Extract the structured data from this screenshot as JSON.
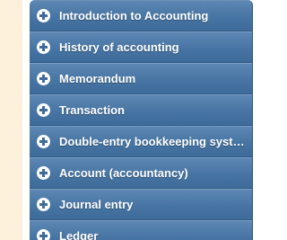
{
  "accordion": {
    "items": [
      {
        "label": "Introduction to Accounting",
        "icon": "plus-icon"
      },
      {
        "label": "History of accounting",
        "icon": "plus-icon"
      },
      {
        "label": "Memorandum",
        "icon": "plus-icon"
      },
      {
        "label": "Transaction",
        "icon": "plus-icon"
      },
      {
        "label": "Double-entry bookkeeping syste…",
        "icon": "plus-icon"
      },
      {
        "label": "Account (accountancy)",
        "icon": "plus-icon"
      },
      {
        "label": "Journal entry",
        "icon": "plus-icon"
      },
      {
        "label": "Ledger",
        "icon": "plus-icon"
      }
    ]
  },
  "colors": {
    "page_margin": "#fdf1dc",
    "header_blue": "#4775a3",
    "icon_fill": "#ffffff",
    "label_text": "#ffffff"
  }
}
